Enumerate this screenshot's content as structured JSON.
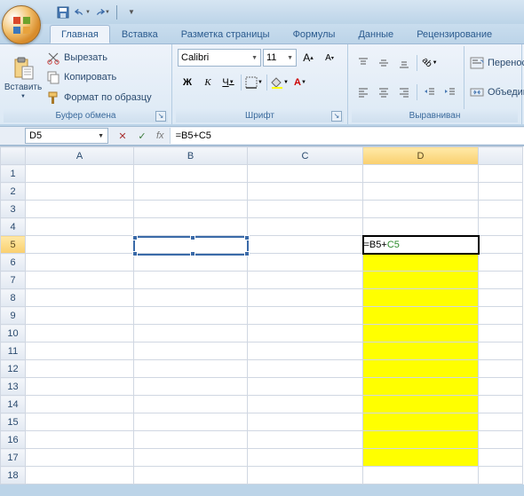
{
  "qat": {
    "save": "save-icon",
    "undo": "undo-icon",
    "redo": "redo-icon"
  },
  "tabs": [
    {
      "label": "Главная",
      "active": true
    },
    {
      "label": "Вставка"
    },
    {
      "label": "Разметка страницы"
    },
    {
      "label": "Формулы"
    },
    {
      "label": "Данные"
    },
    {
      "label": "Рецензирование"
    }
  ],
  "clipboard": {
    "paste": "Вставить",
    "cut": "Вырезать",
    "copy": "Копировать",
    "format_painter": "Формат по образцу",
    "group_label": "Буфер обмена"
  },
  "font": {
    "family": "Calibri",
    "size": "11",
    "group_label": "Шрифт",
    "bold": "Ж",
    "italic": "К",
    "underline": "Ч"
  },
  "alignment": {
    "group_label": "Выравниван",
    "wrap": "Перенос",
    "merge": "Объедин"
  },
  "namebox": "D5",
  "formula": "=B5+C5",
  "columns": [
    "A",
    "B",
    "C",
    "D"
  ],
  "rows": [
    "1",
    "2",
    "3",
    "4",
    "5",
    "6",
    "7",
    "8",
    "9",
    "10",
    "11",
    "12",
    "13",
    "14",
    "15",
    "16",
    "17",
    "18"
  ],
  "cell_d5": "=B5+C5",
  "active_col": "D",
  "active_row": "5"
}
